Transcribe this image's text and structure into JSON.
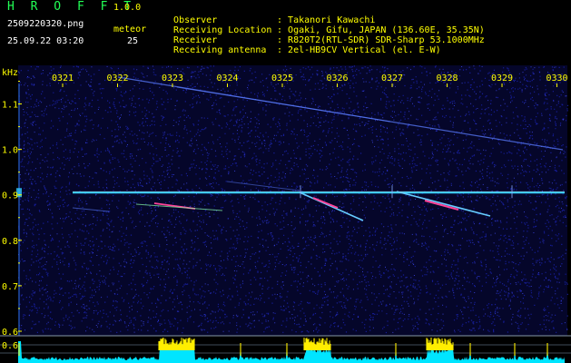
{
  "header": {
    "app_title": "H R O F F T",
    "app_version": "1.0.0",
    "file_name": "2509220320.png",
    "timestamp": "25.09.22 03:20",
    "meteor_label": "meteor",
    "meteor_count": "25"
  },
  "info": [
    {
      "key": "Observer",
      "value": "Takanori Kawachi"
    },
    {
      "key": "Receiving Location",
      "value": "Ogaki, Gifu, JAPAN (136.60E, 35.35N)"
    },
    {
      "key": "Receiver",
      "value": "R820T2(RTL-SDR) SDR-Sharp 53.1000MHz"
    },
    {
      "key": "Receiving antenna",
      "value": "2el-HB9CV Vertical (el. E-W)"
    }
  ],
  "chart_data": {
    "type": "heatmap",
    "ylabel": "kHz",
    "x_ticks": [
      "0321",
      "0322",
      "0323",
      "0324",
      "0325",
      "0326",
      "0327",
      "0328",
      "0329",
      "0330"
    ],
    "y_ticks": [
      "1.1",
      "1.0",
      "0.9",
      "0.8",
      "0.7",
      "0.6"
    ],
    "carrier_khz": 0.905,
    "colors": {
      "background": "#05062a",
      "noise": "#1a22aa",
      "carrier": "#33ccff",
      "meteor_hot": "#ff4499",
      "meteor_trail": "#66ccff",
      "level_fill": "#00e5ff",
      "level_peak": "#ffee00",
      "axis_text": "#ffff00"
    }
  }
}
